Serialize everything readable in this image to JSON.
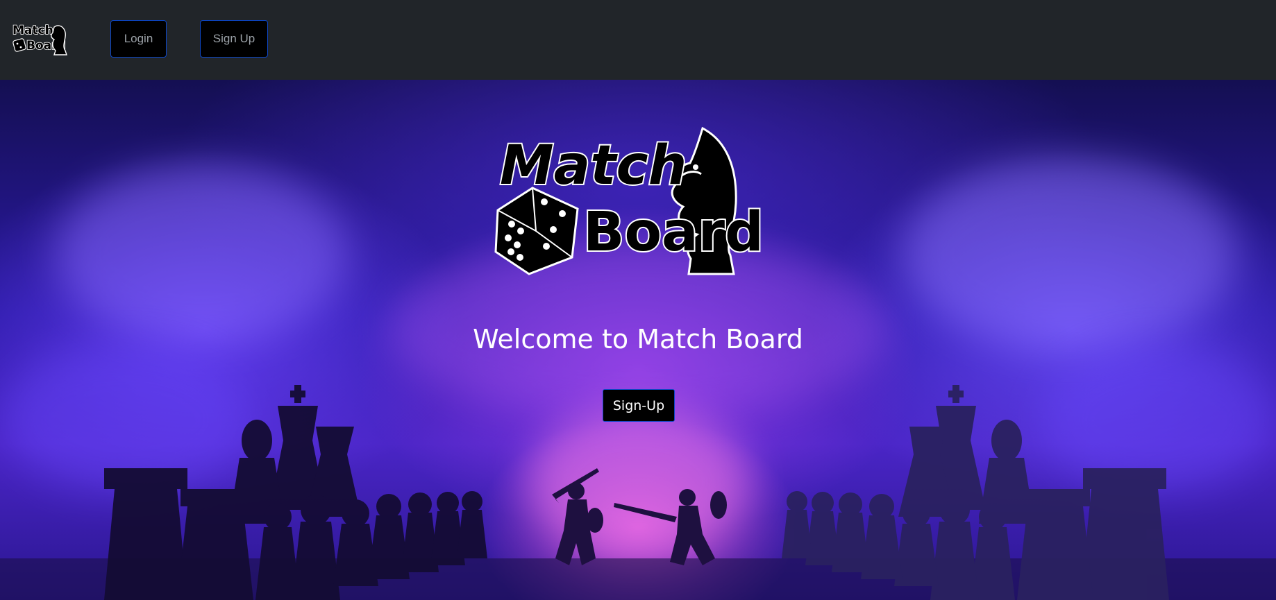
{
  "navbar": {
    "logo_text_line1": "Match",
    "logo_text_line2": "Board",
    "login_label": "Login",
    "signup_label": "Sign Up",
    "background_color": "#212529",
    "button_border_color": "#0d47c6"
  },
  "hero": {
    "logo_text_line1": "Match",
    "logo_text_line2": "Board",
    "title": "Welcome to Match Board",
    "cta_label": "Sign-Up",
    "background_image": "chess-and-warriors-in-purple-smoke"
  },
  "icons": {
    "brand": "knight-icon",
    "dice": "dice-icon"
  }
}
